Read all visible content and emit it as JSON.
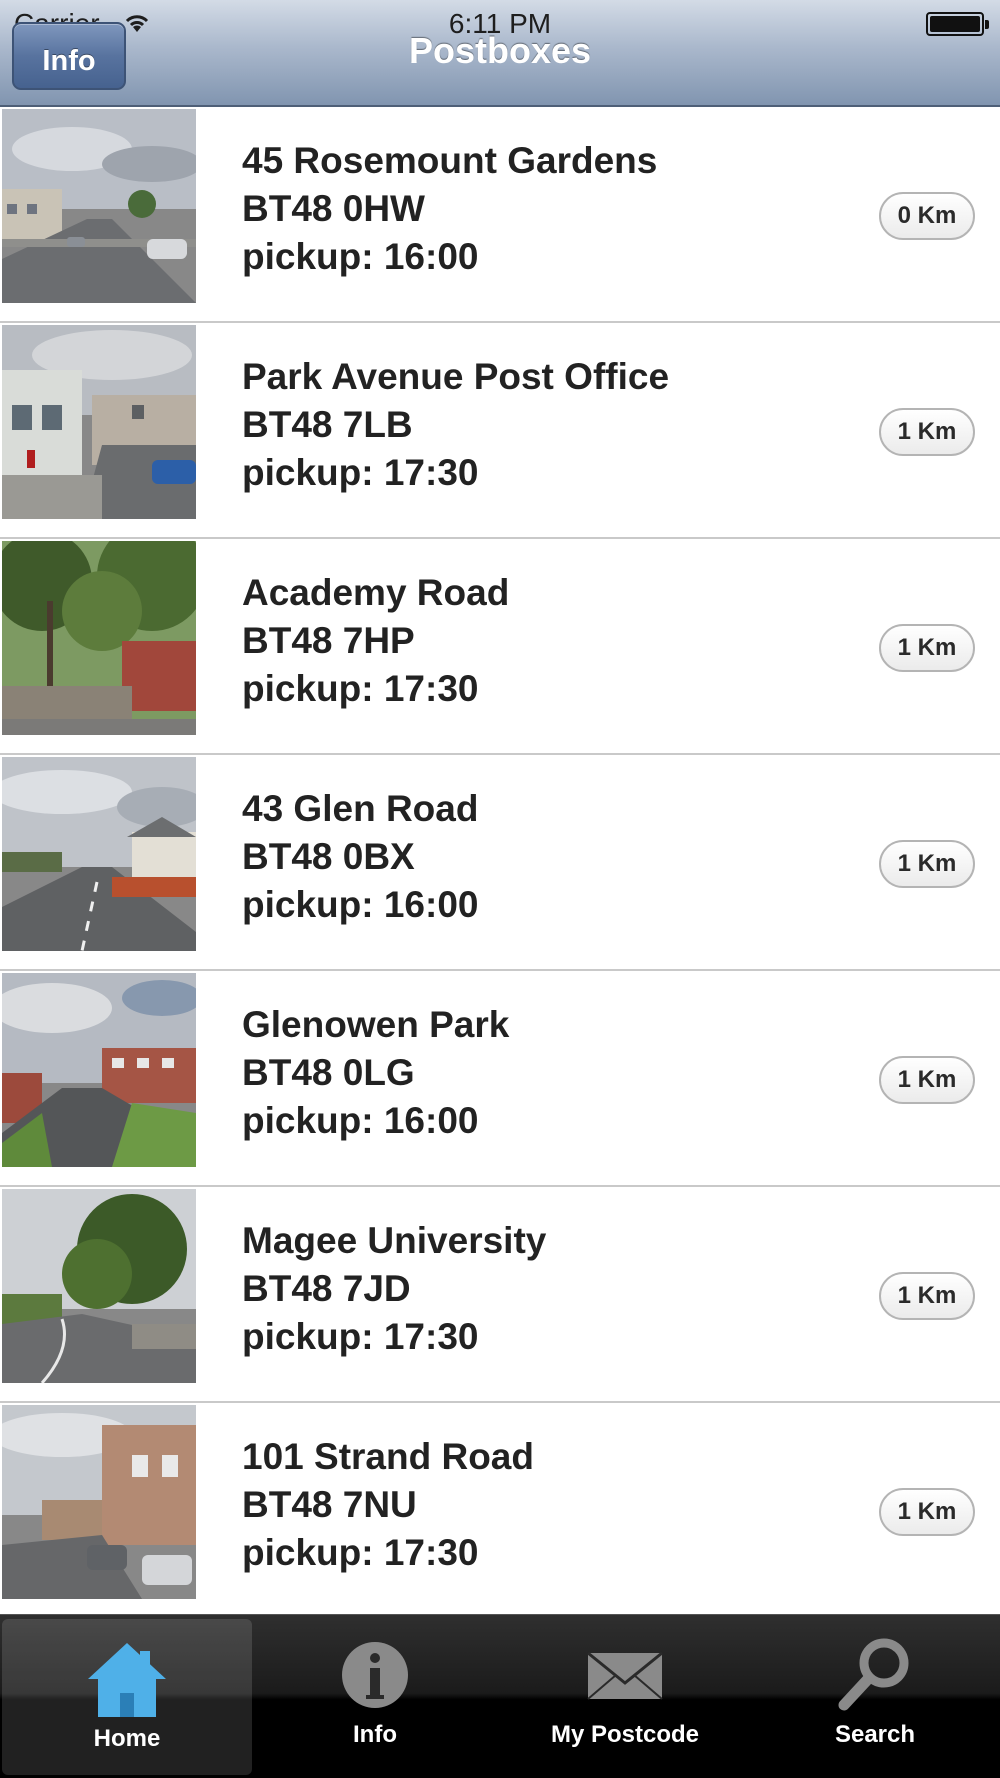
{
  "status_bar": {
    "carrier": "Carrier",
    "time": "6:11 PM"
  },
  "nav": {
    "title": "Postboxes",
    "info_button": "Info"
  },
  "postboxes": [
    {
      "name": "45 Rosemount Gardens",
      "postcode": "BT48 0HW",
      "pickup": "pickup: 16:00",
      "distance": "0 Km"
    },
    {
      "name": "Park Avenue Post Office",
      "postcode": "BT48 7LB",
      "pickup": "pickup: 17:30",
      "distance": "1 Km"
    },
    {
      "name": "Academy Road",
      "postcode": "BT48 7HP",
      "pickup": "pickup: 17:30",
      "distance": "1 Km"
    },
    {
      "name": "43 Glen Road",
      "postcode": "BT48 0BX",
      "pickup": "pickup: 16:00",
      "distance": "1 Km"
    },
    {
      "name": "Glenowen Park",
      "postcode": "BT48 0LG",
      "pickup": "pickup: 16:00",
      "distance": "1 Km"
    },
    {
      "name": "Magee University",
      "postcode": "BT48 7JD",
      "pickup": "pickup: 17:30",
      "distance": "1 Km"
    },
    {
      "name": "101 Strand Road",
      "postcode": "BT48 7NU",
      "pickup": "pickup: 17:30",
      "distance": "1 Km"
    }
  ],
  "tabbar": {
    "tabs": [
      {
        "label": "Home",
        "icon": "home-icon",
        "selected": true
      },
      {
        "label": "Info",
        "icon": "info-icon",
        "selected": false
      },
      {
        "label": "My Postcode",
        "icon": "envelope-icon",
        "selected": false
      },
      {
        "label": "Search",
        "icon": "search-icon",
        "selected": false
      }
    ]
  },
  "colors": {
    "nav_bar": "#8195b0",
    "info_button": "#58739f",
    "text": "#222222",
    "home_icon": "#4fb0e8",
    "tabbar": "#000000"
  }
}
